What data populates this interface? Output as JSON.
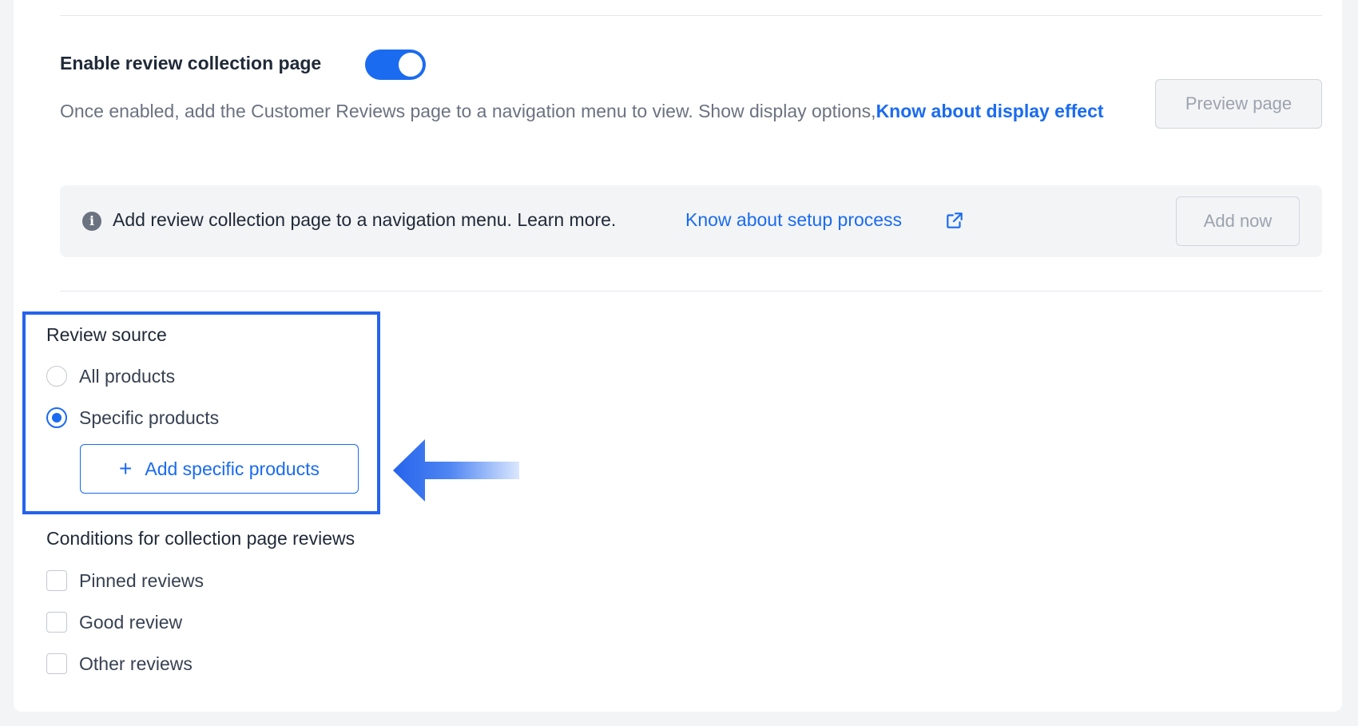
{
  "display_settings": {
    "toggle_title": "Enable review collection page",
    "toggle_state": "on",
    "description_text": "Once enabled, add the Customer Reviews page to a navigation menu to view. Show display options,",
    "description_link": "Know about display effect",
    "preview_button": "Preview page"
  },
  "notice": {
    "icon": "info-icon",
    "text": "Add review collection page to a navigation menu. Learn more.",
    "link": "Know about setup process",
    "link_icon": "external-link-icon",
    "button": "Add now"
  },
  "review_source": {
    "title": "Review source",
    "options": [
      {
        "label": "All products",
        "checked": false
      },
      {
        "label": "Specific products",
        "checked": true
      }
    ],
    "add_button": "Add specific products"
  },
  "conditions": {
    "title": "Conditions for collection page reviews",
    "options": [
      {
        "label": "Pinned reviews",
        "checked": false
      },
      {
        "label": "Good review",
        "checked": false
      },
      {
        "label": "Other reviews",
        "checked": false
      }
    ]
  },
  "colors": {
    "accent": "#1a6bf0",
    "highlight": "#2563eb",
    "page_background": "#f3f4f6"
  }
}
